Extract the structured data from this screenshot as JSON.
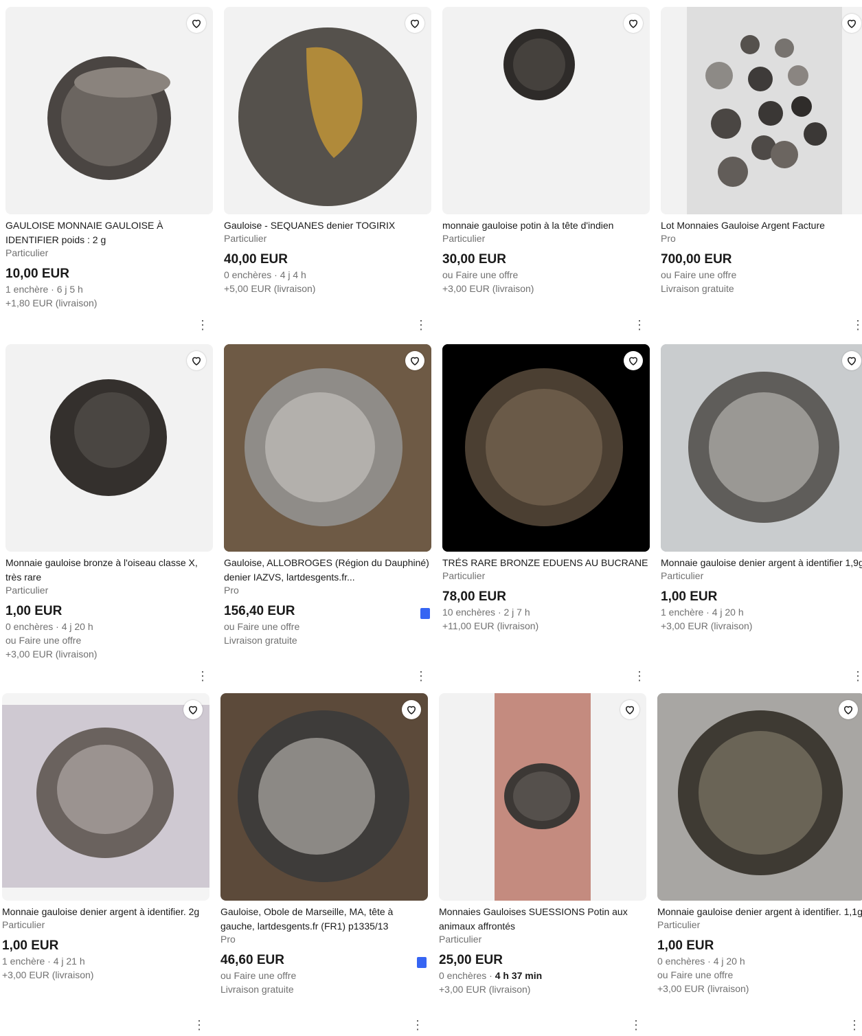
{
  "listings": [
    {
      "title": "GAULOISE MONNAIE GAULOISE À IDENTIFIER poids : 2 g",
      "seller": "Particulier",
      "price": "10,00 EUR",
      "meta": [
        "1 enchère · 6 j 5 h",
        "+1,80 EUR (livraison)"
      ]
    },
    {
      "title": "Gauloise - SEQUANES denier TOGIRIX",
      "seller": "Particulier",
      "price": "40,00 EUR",
      "meta": [
        "0 enchères · 4 j 4 h",
        "+5,00 EUR (livraison)"
      ]
    },
    {
      "title": "monnaie gauloise potin à la tête d'indien",
      "seller": "Particulier",
      "price": "30,00 EUR",
      "meta": [
        "ou Faire une offre",
        "+3,00 EUR (livraison)"
      ]
    },
    {
      "title": "Lot Monnaies Gauloise Argent Facture",
      "seller": "Pro",
      "price": "700,00 EUR",
      "meta": [
        "ou Faire une offre",
        "Livraison gratuite"
      ]
    },
    {
      "title": "Monnaie gauloise bronze à l'oiseau classe X, très rare",
      "seller": "Particulier",
      "price": "1,00 EUR",
      "meta": [
        "0 enchères · 4 j 20 h",
        "ou Faire une offre",
        "+3,00 EUR (livraison)"
      ]
    },
    {
      "title": "Gauloise, ALLOBROGES (Région du Dauphiné) denier IAZVS, lartdesgents.fr...",
      "seller": "Pro",
      "price": "156,40 EUR",
      "meta": [
        "ou Faire une offre",
        "Livraison gratuite"
      ]
    },
    {
      "title": "TRÉS RARE BRONZE EDUENS AU BUCRANE",
      "seller": "Particulier",
      "price": "78,00 EUR",
      "meta": [
        "10 enchères · 2 j 7 h",
        "+11,00 EUR (livraison)"
      ]
    },
    {
      "title": "Monnaie gauloise denier argent à identifier 1,9g",
      "seller": "Particulier",
      "price": "1,00 EUR",
      "meta": [
        "1 enchère · 4 j 20 h",
        "+3,00 EUR (livraison)"
      ]
    },
    {
      "title": "Monnaie gauloise denier argent à identifier. 2g",
      "seller": "Particulier",
      "price": "1,00 EUR",
      "meta": [
        "1 enchère · 4 j 21 h",
        "+3,00 EUR (livraison)"
      ]
    },
    {
      "title": "Gauloise, Obole de Marseille, MA, tête à gauche, lartdesgents.fr (FR1) p1335/13",
      "seller": "Pro",
      "price": "46,60 EUR",
      "meta": [
        "ou Faire une offre",
        "Livraison gratuite"
      ]
    },
    {
      "title": "Monnaies Gauloises SUESSIONS Potin aux animaux affrontés",
      "seller": "Particulier",
      "price": "25,00 EUR",
      "meta": [
        "0 enchères · ",
        "+3,00 EUR (livraison)"
      ],
      "meta_bold": "4 h 37 min"
    },
    {
      "title": "Monnaie gauloise denier argent à identifier. 1,1g",
      "seller": "Particulier",
      "price": "1,00 EUR",
      "meta": [
        "0 enchères · 4 j 20 h",
        "ou Faire une offre",
        "+3,00 EUR (livraison)"
      ]
    }
  ],
  "icons": {
    "favorite": "heart-icon",
    "more": "more-vertical-icon",
    "top_seller": "badge-icon"
  },
  "colors": {
    "badge": "#3665f3",
    "muted": "#707070"
  }
}
